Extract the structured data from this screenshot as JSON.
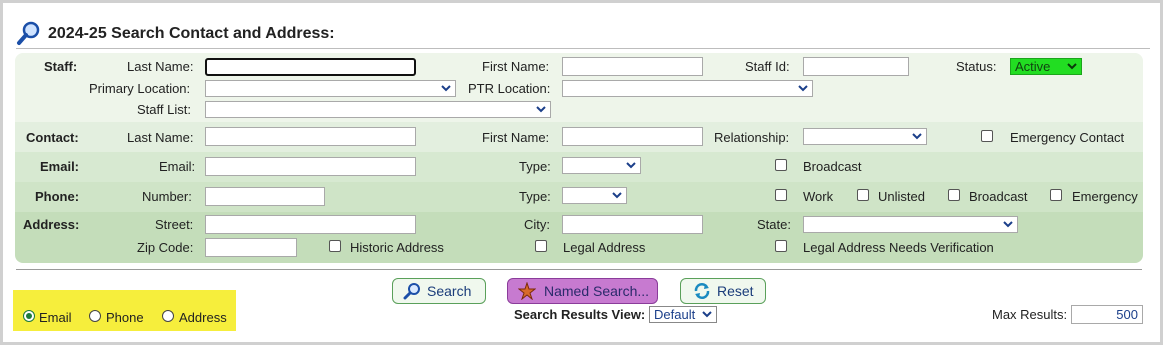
{
  "title": "2024-25 Search Contact and Address:",
  "staff": {
    "section": "Staff:",
    "last_name": "Last Name:",
    "first_name": "First Name:",
    "staff_id": "Staff Id:",
    "status_label": "Status:",
    "status_value": "Active",
    "primary_location": "Primary Location:",
    "ptr_location": "PTR Location:",
    "staff_list": "Staff List:"
  },
  "contact": {
    "section": "Contact:",
    "last_name": "Last Name:",
    "first_name": "First Name:",
    "relationship": "Relationship:",
    "emergency_contact": "Emergency Contact"
  },
  "email": {
    "section": "Email:",
    "email": "Email:",
    "type": "Type:",
    "broadcast": "Broadcast"
  },
  "phone": {
    "section": "Phone:",
    "number": "Number:",
    "type": "Type:",
    "work": "Work",
    "unlisted": "Unlisted",
    "broadcast": "Broadcast",
    "emergency": "Emergency"
  },
  "address": {
    "section": "Address:",
    "street": "Street:",
    "city": "City:",
    "state": "State:",
    "zip": "Zip Code:",
    "historic": "Historic Address",
    "legal": "Legal Address",
    "legal_verify": "Legal Address Needs Verification"
  },
  "buttons": {
    "search": "Search",
    "named_search": "Named Search...",
    "reset": "Reset"
  },
  "results": {
    "view_label": "Search Results View:",
    "view_value": "Default",
    "max_label": "Max Results:",
    "max_value": "500"
  },
  "radios": {
    "options": [
      "Email",
      "Phone",
      "Address"
    ],
    "selected": "Email"
  },
  "colors": {
    "panel_light": "#eef5ea",
    "panel_mid": "#d7e9d1",
    "panel_dark": "#c4ddba",
    "status_green": "#22dd22",
    "highlight": "#f6ee3c"
  }
}
